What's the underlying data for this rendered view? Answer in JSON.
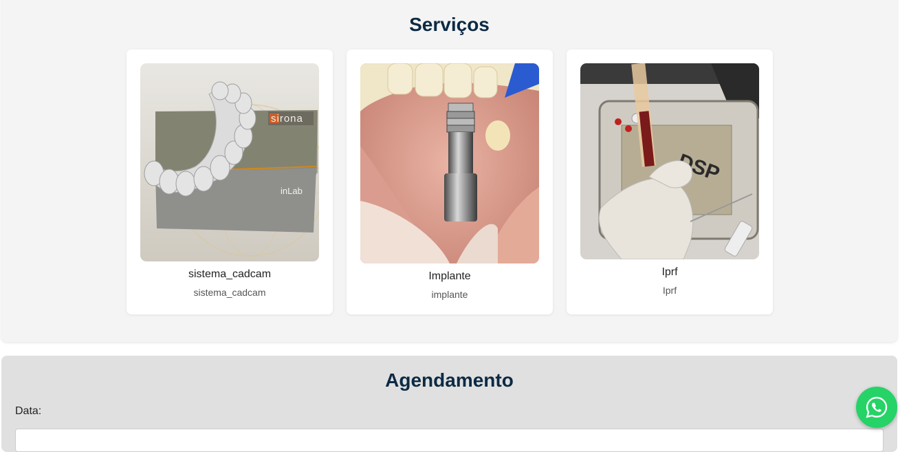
{
  "services": {
    "title": "Serviços",
    "cards": [
      {
        "title": "sistema_cadcam",
        "subtitle": "sistema_cadcam",
        "image_text": {
          "brand": "sirona",
          "product": "inLab"
        }
      },
      {
        "title": "Implante",
        "subtitle": "implante"
      },
      {
        "title": "Iprf",
        "subtitle": "Iprf",
        "image_text": {
          "kit": "DSP"
        }
      }
    ]
  },
  "booking": {
    "title": "Agendamento",
    "date_label": "Data:"
  },
  "whatsapp": {
    "icon": "whatsapp-icon",
    "color": "#25d366"
  }
}
